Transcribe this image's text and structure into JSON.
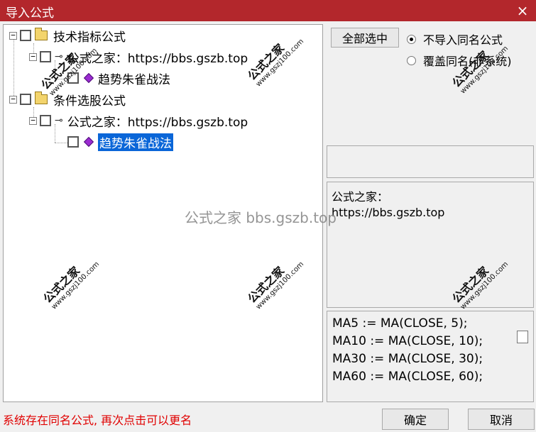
{
  "window": {
    "title": "导入公式",
    "close_label": "×"
  },
  "tree": {
    "nodes": [
      {
        "label": "技术指标公式",
        "icon": "folder-icon"
      },
      {
        "label": "公式之家：https://bbs.gszb.top",
        "icon": "key-icon"
      },
      {
        "label": "趋势朱雀战法",
        "icon": "formula-gem-icon"
      },
      {
        "label": "条件选股公式",
        "icon": "folder-icon"
      },
      {
        "label": "公式之家：https://bbs.gszb.top",
        "icon": "key-icon"
      },
      {
        "label": "趋势朱雀战法",
        "icon": "formula-gem-icon",
        "selected": true
      }
    ]
  },
  "right_panel": {
    "select_all_label": "全部选中",
    "radio_options": [
      {
        "label": "不导入同名公式",
        "checked": true
      },
      {
        "label": "覆盖同名(非系统)",
        "checked": false
      }
    ],
    "description_lines": [
      "公式之家：",
      "https://bbs.gszb.top"
    ],
    "code_lines": [
      "MA5 := MA(CLOSE, 5);",
      "MA10 := MA(CLOSE, 10);",
      "MA30 := MA(CLOSE, 30);",
      "MA60 := MA(CLOSE, 60);"
    ]
  },
  "footer": {
    "status_text": "系统存在同名公式, 再次点击可以更名",
    "ok_label": "确定",
    "cancel_label": "取消"
  },
  "watermarks": {
    "center_text": "公式之家 bbs.gszb.top",
    "stamp_title": "公式之家",
    "stamp_url": "www.gszj100.com"
  },
  "colors": {
    "titlebar": "#b3272c",
    "selection": "#0a66d8",
    "status_text": "#e00000"
  }
}
